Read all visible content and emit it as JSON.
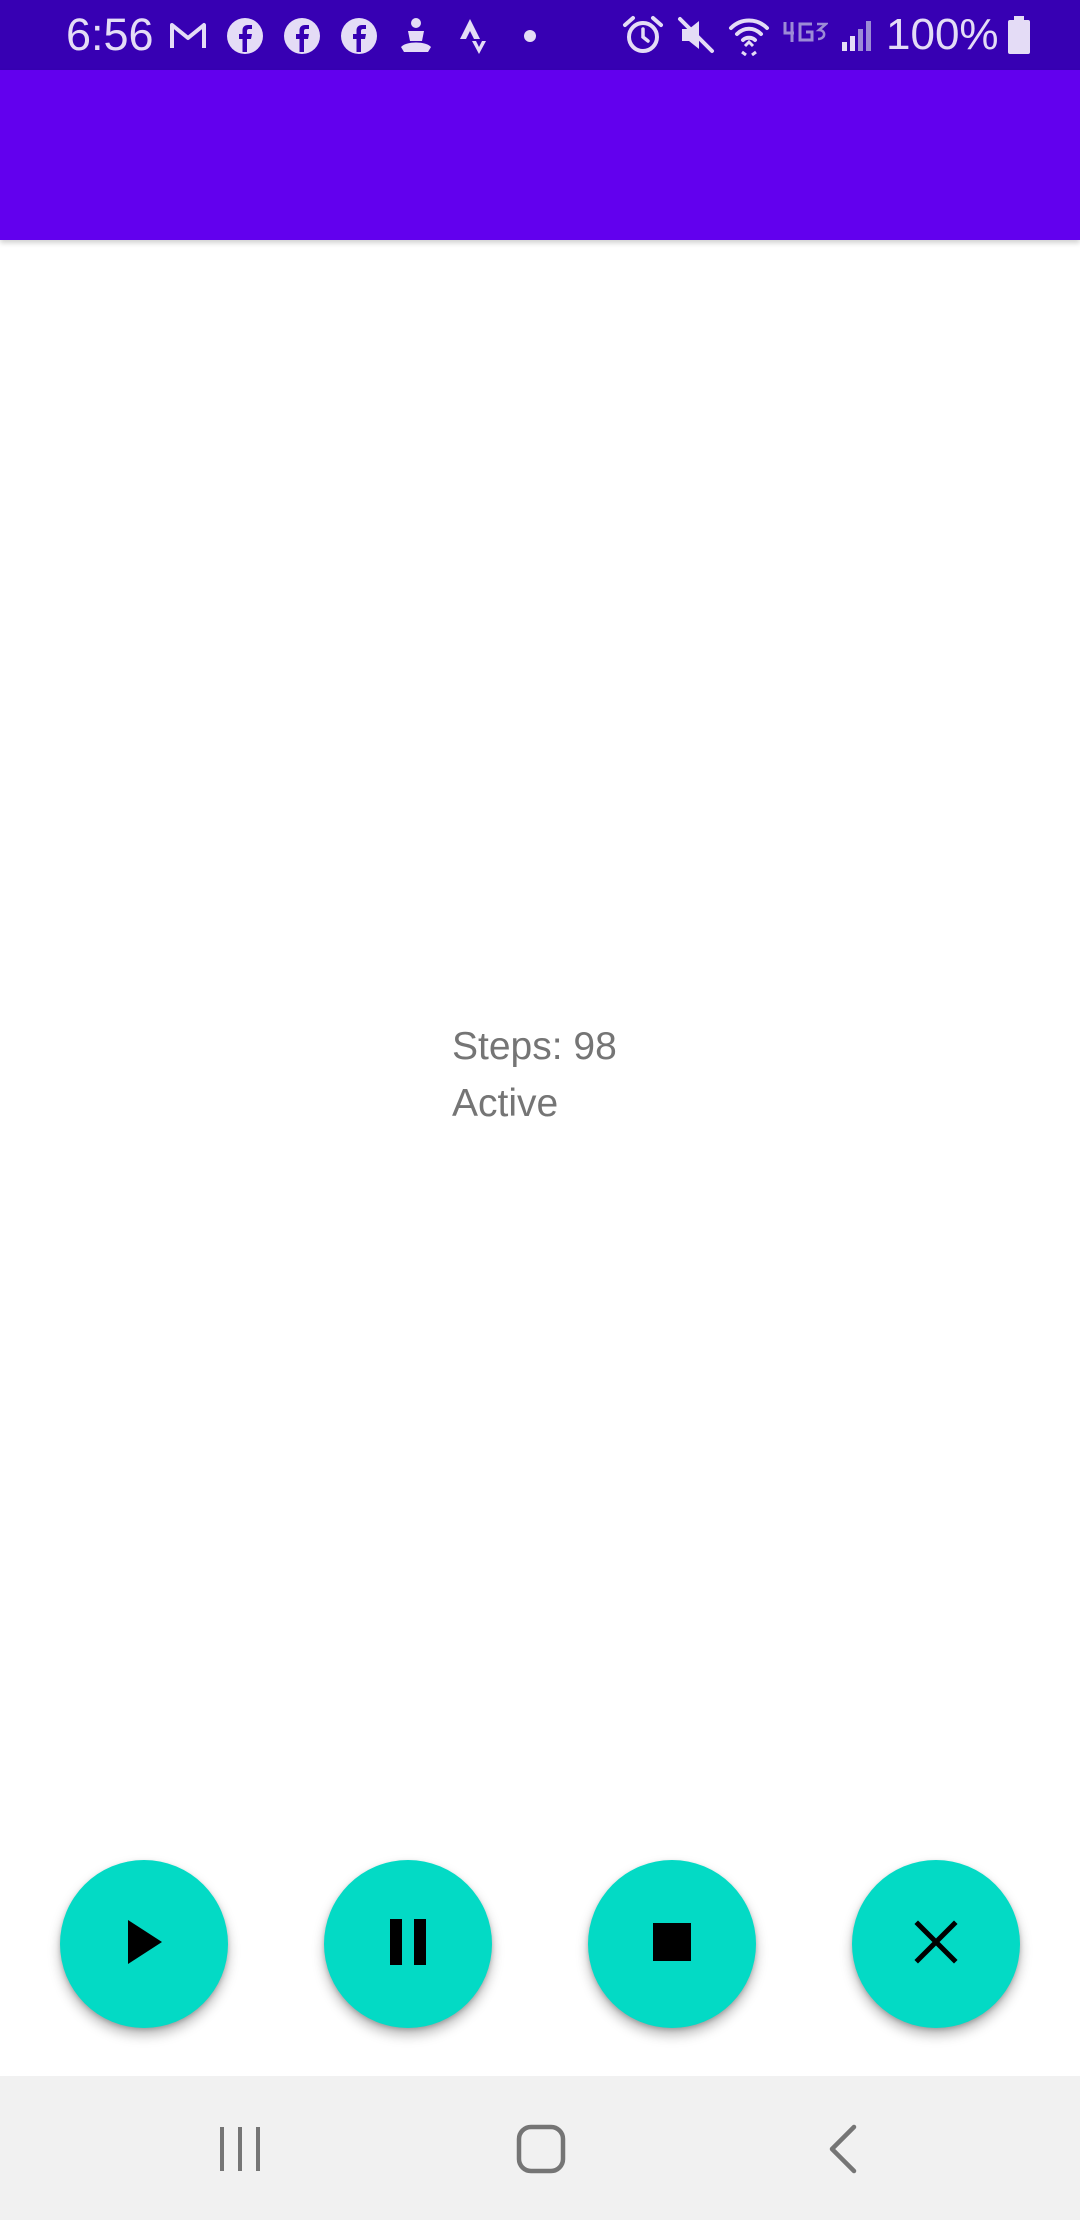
{
  "status_bar": {
    "time": "6:56",
    "battery_percent": "100%",
    "notification_icons": [
      "gmail-icon",
      "facebook-icon",
      "facebook-icon",
      "facebook-icon",
      "meditation-app-icon",
      "strava-icon",
      "more-notifications-dot-icon"
    ],
    "system_icons": [
      "alarm-icon",
      "mute-icon",
      "wifi-icon",
      "4g-icon",
      "cellular-signal-icon",
      "battery-icon"
    ],
    "colors": {
      "background": "#3700B3",
      "foreground": "#E4DCF6"
    }
  },
  "app_bar": {
    "color": "#6200EE"
  },
  "main": {
    "steps_text": "Steps: 98",
    "status_text": "Active",
    "text_color": "#757575"
  },
  "controls": {
    "accent_color": "#03DAC5",
    "buttons": [
      {
        "icon": "play-icon"
      },
      {
        "icon": "pause-icon"
      },
      {
        "icon": "stop-icon"
      },
      {
        "icon": "close-icon"
      }
    ]
  },
  "nav_bar": {
    "buttons": [
      "recents-icon",
      "home-icon",
      "back-icon"
    ],
    "background": "#F1F1F1"
  }
}
